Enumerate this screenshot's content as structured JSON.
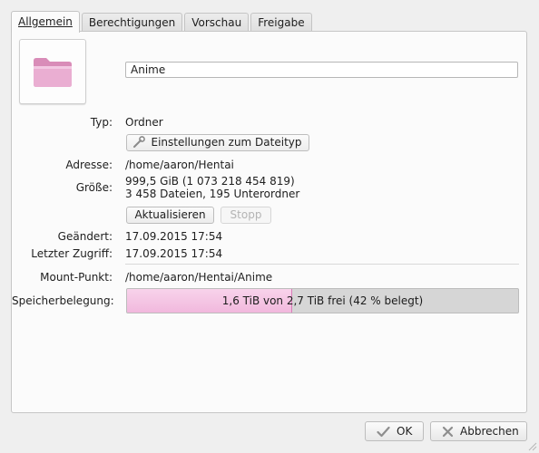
{
  "tabs": [
    {
      "label": "Allgemein",
      "active": true
    },
    {
      "label": "Berechtigungen",
      "active": false
    },
    {
      "label": "Vorschau",
      "active": false
    },
    {
      "label": "Freigabe",
      "active": false
    }
  ],
  "folder_icon": "folder-pink-icon",
  "name_value": "Anime",
  "type": {
    "label": "Typ:",
    "value": "Ordner"
  },
  "filetype_settings_button": "Einstellungen zum Dateityp",
  "address": {
    "label": "Adresse:",
    "value": "/home/aaron/Hentai"
  },
  "size": {
    "label": "Größe:",
    "line1": "999,5 GiB (1 073 218 454 819)",
    "line2": "3 458 Dateien, 195 Unterordner"
  },
  "refresh_button": "Aktualisieren",
  "stop_button": "Stopp",
  "modified": {
    "label": "Geändert:",
    "value": "17.09.2015 17:54"
  },
  "accessed": {
    "label": "Letzter Zugriff:",
    "value": "17.09.2015 17:54"
  },
  "mount_point": {
    "label": "Mount-Punkt:",
    "value": "/home/aaron/Hentai/Anime"
  },
  "storage": {
    "label": "Speicherbelegung:",
    "text": "1,6 TiB von 2,7 TiB frei (42 % belegt)",
    "used_percent": 42
  },
  "ok_button": "OK",
  "cancel_button": "Abbrechen",
  "colors": {
    "accent_pink": "#f1b8dd",
    "icon_pink": "#e6a3c9"
  }
}
